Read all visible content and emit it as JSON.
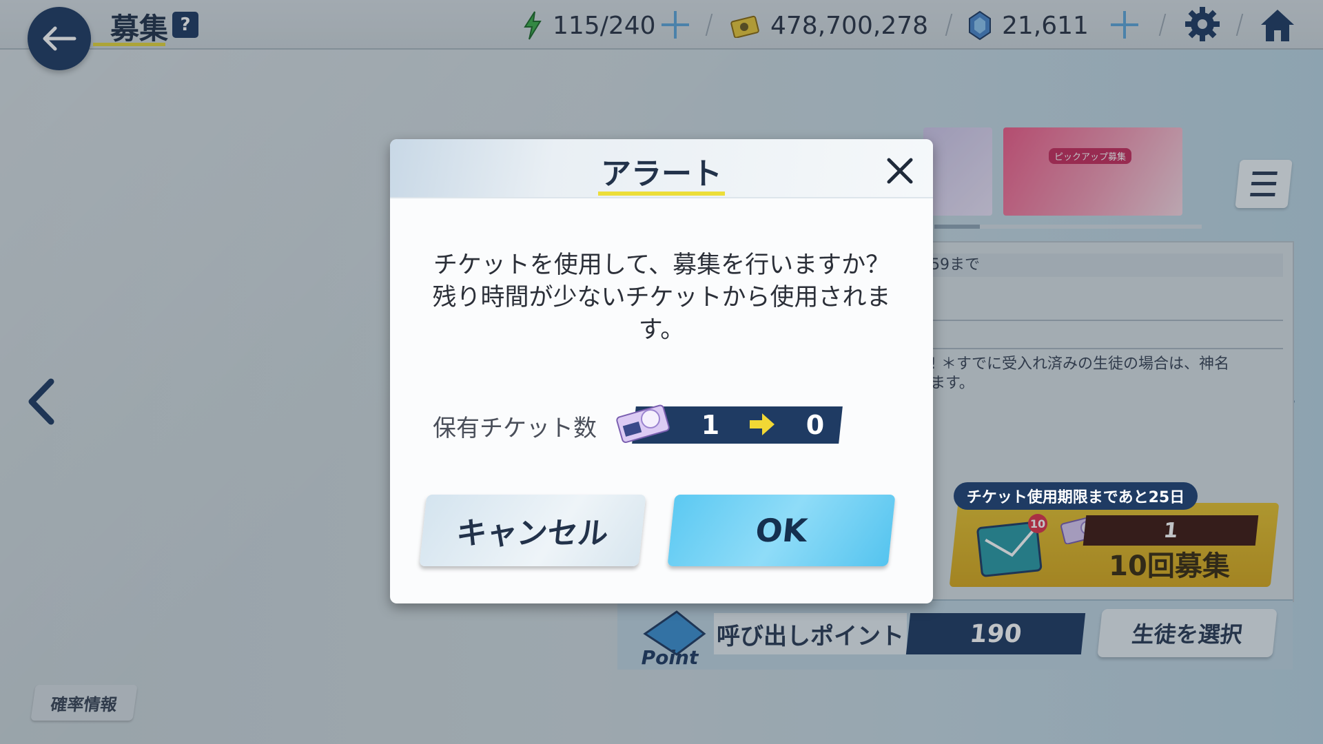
{
  "header": {
    "title": "募集",
    "help": "?",
    "stamina": "115/240",
    "credits": "478,700,278",
    "gems": "21,611"
  },
  "background": {
    "banner_tag": "ピックアップ募集",
    "info_date": "59まで",
    "info_text_line1": "! ＊すでに受入れ済みの生徒の場合は、神名",
    "info_text_line2": "ます。",
    "ticket_expire": "チケット使用期限まであと25日",
    "ticket_count": "1",
    "recruit_10": "10回募集",
    "mail_badge": "10",
    "point_label": "呼び出しポイント",
    "point_value": "190",
    "point_icon_text": "Point",
    "select_student": "生徒を選択",
    "rate_info": "確率情報"
  },
  "dialog": {
    "title": "アラート",
    "message_line1": "チケットを使用して、募集を行いますか？",
    "message_line2": "残り時間が少ないチケットから使用されま",
    "message_line3": "す。",
    "ticket_label": "保有チケット数",
    "ticket_from": "1",
    "ticket_to": "0",
    "cancel": "キャンセル",
    "ok": "OK"
  },
  "colors": {
    "navy": "#1f3b63",
    "accent_yellow": "#ecde3a",
    "ok_blue": "#5cc9f2"
  }
}
